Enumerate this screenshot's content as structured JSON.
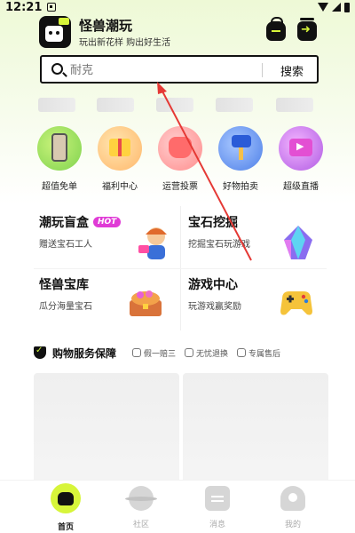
{
  "status_bar": {
    "time": "12:21"
  },
  "header": {
    "app_title": "怪兽潮玩",
    "app_subtitle": "玩出新花样 购出好生活",
    "bag_icon": "shopping-bag-icon",
    "share_icon": "share-icon"
  },
  "search": {
    "placeholder": "耐克",
    "button_label": "搜索"
  },
  "categories": [
    {
      "label": "超值免单",
      "icon": "phone-icon",
      "color": "#7fd34f"
    },
    {
      "label": "福利中心",
      "icon": "gift-icon",
      "color": "#ffb76b"
    },
    {
      "label": "运营投票",
      "icon": "vote-hand-icon",
      "color": "#ff8c8c"
    },
    {
      "label": "好物拍卖",
      "icon": "auction-hammer-icon",
      "color": "#4d7fe8"
    },
    {
      "label": "超级直播",
      "icon": "tv-icon",
      "color": "#b05be3"
    }
  ],
  "promos": [
    {
      "title": "潮玩盲盒",
      "badge": "HOT",
      "subtitle": "赠送宝石工人"
    },
    {
      "title": "宝石挖掘",
      "subtitle": "挖掘宝石玩游戏"
    },
    {
      "title": "怪兽宝库",
      "subtitle": "瓜分海量宝石"
    },
    {
      "title": "游戏中心",
      "subtitle": "玩游戏赢奖励"
    }
  ],
  "service": {
    "title": "购物服务保障",
    "items": [
      "假一赔三",
      "无忧退换",
      "专属售后"
    ]
  },
  "tabbar": {
    "items": [
      {
        "label": "首页",
        "active": true
      },
      {
        "label": "社区",
        "active": false
      },
      {
        "label": "消息",
        "active": false
      },
      {
        "label": "我的",
        "active": false
      }
    ]
  },
  "colors": {
    "accent": "#d7f53a",
    "hot_badge": "#e03bd6",
    "annotation_arrow": "#e53935"
  }
}
